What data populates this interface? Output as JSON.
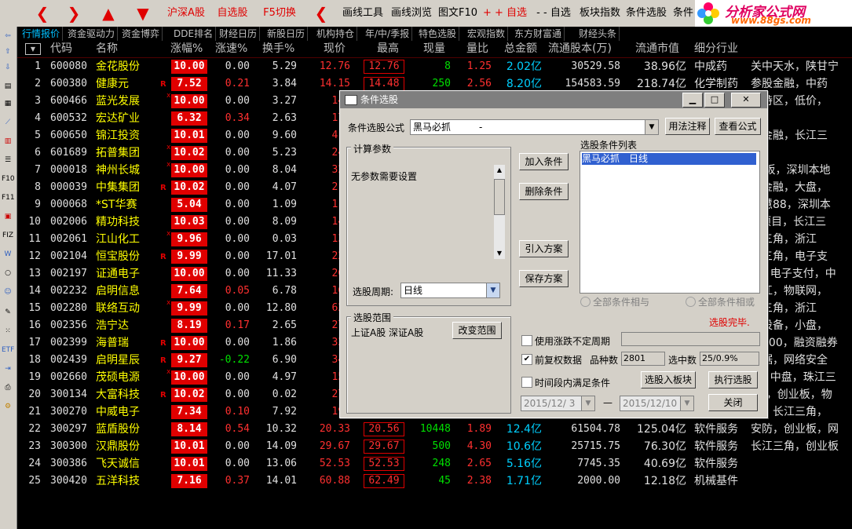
{
  "toolbar": {
    "tabs": [
      "沪深A股",
      "自选股",
      "F5切换",
      "画线工具",
      "画线浏览",
      "图文F10",
      "+ + 自选",
      "- - 自选",
      "板块指数",
      "条件选股",
      "条件"
    ],
    "logo_text": "分析家公式网",
    "logo_url": "www.88gs.com"
  },
  "left_icons": [
    "F10",
    "F11",
    "FIZ",
    "W",
    "ETF"
  ],
  "tabs": [
    "行情报价",
    "资金驱动力",
    "资金博弈",
    "DDE排名",
    "财经日历",
    "新股日历",
    "机构持仓",
    "年/中/季报",
    "特色选股",
    "宏观指数",
    "东方财富通",
    "财经头条"
  ],
  "columns": [
    "代码",
    "名称",
    "涨幅%",
    "涨速%",
    "换手%",
    "现价",
    "最高",
    "现量",
    "量比",
    "总金额",
    "流通股本(万)",
    "流通市值",
    "细分行业"
  ],
  "rows": [
    {
      "no": "1",
      "code": "600080",
      "name": "金花股份",
      "mark": "",
      "chg": "10.00",
      "spd": "0.00",
      "turn": "5.29",
      "price": "12.76",
      "high": "12.76",
      "vol": "8",
      "ratio": "1.25",
      "amt": "2.02亿",
      "float": "30529.58",
      "fmv": "38.96亿",
      "ind": "中成药",
      "extra": "关中天水，陕甘宁"
    },
    {
      "no": "2",
      "code": "600380",
      "name": "健康元",
      "mark": "R",
      "chg": "7.52",
      "spd": "0.21",
      "turn": "3.84",
      "price": "14.15",
      "high": "14.48",
      "vol": "250",
      "ratio": "2.56",
      "amt": "8.20亿",
      "float": "154583.59",
      "fmv": "218.74亿",
      "ind": "化学制药",
      "extra": "参股金融，中药"
    },
    {
      "no": "3",
      "code": "600466",
      "name": "蓝光发展",
      "mark": "x",
      "chg": "10.00",
      "spd": "0.00",
      "turn": "3.27",
      "price": "14.",
      "high": "",
      "vol": "",
      "ratio": "",
      "amt": "",
      "float": "",
      "fmv": "",
      "ind": "",
      "extra": "渝特区，低价，"
    },
    {
      "no": "4",
      "code": "600532",
      "name": "宏达矿业",
      "mark": "",
      "chg": "6.32",
      "spd": "0.34",
      "turn": "2.63",
      "price": "17.",
      "high": "",
      "vol": "",
      "ratio": "",
      "amt": "",
      "float": "",
      "fmv": "",
      "ind": "",
      "extra": ""
    },
    {
      "no": "5",
      "code": "600650",
      "name": "锦江投资",
      "mark": "",
      "chg": "10.01",
      "spd": "0.00",
      "turn": "9.60",
      "price": "41.",
      "high": "",
      "vol": "",
      "ratio": "",
      "amt": "",
      "float": "",
      "fmv": "",
      "ind": "",
      "extra": "股金融，长江三"
    },
    {
      "no": "6",
      "code": "601689",
      "name": "拓普集团",
      "mark": "x",
      "chg": "10.02",
      "spd": "0.00",
      "turn": "5.23",
      "price": "24.",
      "high": "",
      "vol": "",
      "ratio": "",
      "amt": "",
      "float": "",
      "fmv": "",
      "ind": "",
      "extra": ""
    },
    {
      "no": "7",
      "code": "000018",
      "name": "神州长城",
      "mark": "x",
      "chg": "10.00",
      "spd": "0.00",
      "turn": "8.04",
      "price": "32.",
      "high": "",
      "vol": "",
      "ratio": "",
      "amt": "",
      "float": "",
      "fmv": "",
      "ind": "",
      "extra": "ST板，深圳本地"
    },
    {
      "no": "8",
      "code": "000039",
      "name": "中集集团",
      "mark": "R",
      "chg": "10.02",
      "spd": "0.00",
      "turn": "4.07",
      "price": "21.",
      "high": "",
      "vol": "",
      "ratio": "",
      "amt": "",
      "float": "",
      "fmv": "",
      "ind": "",
      "extra": "股金融，大盘，"
    },
    {
      "no": "9",
      "code": "000068",
      "name": "*ST华赛",
      "mark": "",
      "chg": "5.04",
      "spd": "0.00",
      "turn": "1.09",
      "price": "11.",
      "high": "",
      "vol": "",
      "ratio": "",
      "amt": "",
      "float": "",
      "fmv": "",
      "ind": "",
      "extra": "智慧88，深圳本"
    },
    {
      "no": "10",
      "code": "002006",
      "name": "精功科技",
      "mark": "",
      "chg": "10.03",
      "spd": "0.00",
      "turn": "8.09",
      "price": "14.",
      "high": "",
      "vol": "",
      "ratio": "",
      "amt": "",
      "float": "",
      "fmv": "",
      "ind": "",
      "extra": "M项目，长江三"
    },
    {
      "no": "11",
      "code": "002061",
      "name": "江山化工",
      "mark": "x",
      "chg": "9.96",
      "spd": "0.00",
      "turn": "0.03",
      "price": "13.",
      "high": "",
      "vol": "",
      "ratio": "",
      "amt": "",
      "float": "",
      "fmv": "",
      "ind": "",
      "extra": "江三角，浙江"
    },
    {
      "no": "12",
      "code": "002104",
      "name": "恒宝股份",
      "mark": "R",
      "chg": "9.99",
      "spd": "0.00",
      "turn": "17.01",
      "price": "22.",
      "high": "",
      "vol": "",
      "ratio": "",
      "amt": "",
      "float": "",
      "fmv": "",
      "ind": "",
      "extra": "江三角，电子支"
    },
    {
      "no": "13",
      "code": "002197",
      "name": "证通电子",
      "mark": "",
      "chg": "10.00",
      "spd": "0.00",
      "turn": "11.33",
      "price": "26.",
      "high": "",
      "vol": "",
      "ratio": "",
      "amt": "",
      "float": "",
      "fmv": "",
      "ind": "",
      "extra": "D，电子支付，中"
    },
    {
      "no": "14",
      "code": "002232",
      "name": "启明信息",
      "mark": "",
      "chg": "7.64",
      "spd": "0.05",
      "turn": "6.78",
      "price": "16.",
      "high": "",
      "vol": "",
      "ratio": "",
      "amt": "",
      "float": "",
      "fmv": "",
      "ind": "",
      "extra": "门江，物联网，"
    },
    {
      "no": "15",
      "code": "002280",
      "name": "联络互动",
      "mark": "x",
      "chg": "9.99",
      "spd": "0.00",
      "turn": "12.80",
      "price": "62.",
      "high": "",
      "vol": "",
      "ratio": "",
      "amt": "",
      "float": "",
      "fmv": "",
      "ind": "",
      "extra": "江三角，浙江"
    },
    {
      "no": "16",
      "code": "002356",
      "name": "浩宁达",
      "mark": "",
      "chg": "8.19",
      "spd": "0.17",
      "turn": "2.65",
      "price": "27.",
      "high": "",
      "vol": "",
      "ratio": "",
      "amt": "",
      "float": "",
      "fmv": "",
      "ind": "",
      "extra": "力设备，小盘，"
    },
    {
      "no": "17",
      "code": "002399",
      "name": "海普瑞",
      "mark": "R",
      "chg": "10.00",
      "spd": "0.00",
      "turn": "1.86",
      "price": "33.",
      "high": "",
      "vol": "",
      "ratio": "",
      "amt": "",
      "float": "",
      "fmv": "",
      "ind": "",
      "extra": "深300，融资融券"
    },
    {
      "no": "18",
      "code": "002439",
      "name": "启明星辰",
      "mark": "R",
      "chg": "9.27",
      "spd": "-0.22",
      "turn": "6.90",
      "price": "34.",
      "high": "",
      "vol": "",
      "ratio": "",
      "amt": "",
      "float": "",
      "fmv": "",
      "ind": "",
      "extra": "数据，网络安全"
    },
    {
      "no": "19",
      "code": "002660",
      "name": "茂硕电源",
      "mark": "x",
      "chg": "10.00",
      "spd": "0.00",
      "turn": "4.97",
      "price": "15.",
      "high": "",
      "vol": "",
      "ratio": "",
      "amt": "",
      "float": "",
      "fmv": "",
      "ind": "",
      "extra": "D，中盘，珠江三"
    },
    {
      "no": "20",
      "code": "300134",
      "name": "大富科技",
      "mark": "R",
      "chg": "10.02",
      "spd": "0.00",
      "turn": "0.02",
      "price": "27.",
      "high": "",
      "vol": "",
      "ratio": "",
      "amt": "",
      "float": "",
      "fmv": "",
      "ind": "",
      "extra": "5G，创业板，物"
    },
    {
      "no": "21",
      "code": "300270",
      "name": "中威电子",
      "mark": "",
      "chg": "7.34",
      "spd": "0.10",
      "turn": "7.92",
      "price": "19.",
      "high": "",
      "vol": "",
      "ratio": "",
      "amt": "",
      "float": "",
      "fmv": "",
      "ind": "",
      "extra": "防，长江三角，"
    },
    {
      "no": "22",
      "code": "300297",
      "name": "蓝盾股份",
      "mark": "",
      "chg": "8.14",
      "spd": "0.54",
      "turn": "10.32",
      "price": "20.33",
      "high": "20.56",
      "vol": "10448",
      "ratio": "1.89",
      "amt": "12.4亿",
      "float": "61504.78",
      "fmv": "125.04亿",
      "ind": "软件服务",
      "extra": "安防，创业板，网"
    },
    {
      "no": "23",
      "code": "300300",
      "name": "汉鼎股份",
      "mark": "",
      "chg": "10.01",
      "spd": "0.00",
      "turn": "14.09",
      "price": "29.67",
      "high": "29.67",
      "vol": "500",
      "ratio": "4.30",
      "amt": "10.6亿",
      "float": "25715.75",
      "fmv": "76.30亿",
      "ind": "软件服务",
      "extra": "长江三角，创业板"
    },
    {
      "no": "24",
      "code": "300386",
      "name": "飞天诚信",
      "mark": "",
      "chg": "10.01",
      "spd": "0.00",
      "turn": "13.06",
      "price": "52.53",
      "high": "52.53",
      "vol": "248",
      "ratio": "2.65",
      "amt": "5.16亿",
      "float": "7745.35",
      "fmv": "40.69亿",
      "ind": "软件服务",
      "extra": ""
    },
    {
      "no": "25",
      "code": "300420",
      "name": "五洋科技",
      "mark": "",
      "chg": "7.16",
      "spd": "0.37",
      "turn": "14.01",
      "price": "60.88",
      "high": "62.49",
      "vol": "45",
      "ratio": "2.38",
      "amt": "1.71亿",
      "float": "2000.00",
      "fmv": "12.18亿",
      "ind": "机械基件",
      "extra": ""
    }
  ],
  "dialog": {
    "title": "条件选股",
    "formula_label": "条件选股公式",
    "formula_value": "黑马必抓　　　-",
    "btn_usage": "用法注释",
    "btn_view": "查看公式",
    "params_group": "计算参数",
    "no_params": "无参数需要设置",
    "period_label": "选股周期:",
    "period_value": "日线",
    "range_group": "选股范围",
    "range_value": "上证A股 深证A股",
    "btn_change_range": "改变范围",
    "btn_add": "加入条件",
    "btn_delete": "删除条件",
    "btn_import": "引入方案",
    "btn_save": "保存方案",
    "list_label": "选股条件列表",
    "list_item": "黑马必抓　日线",
    "radio_and": "全部条件相与",
    "radio_or": "全部条件相或",
    "status": "选股完毕.",
    "chk_uncertain": "使用涨跌不定周期",
    "chk_restore": "前复权数据",
    "count_label": "品种数",
    "count_value": "2801",
    "selected_label": "选中数",
    "selected_value": "25/0.9%",
    "chk_period": "时间段内满足条件",
    "btn_to_block": "选股入板块",
    "btn_execute": "执行选股",
    "date_from": "2015/12/ 3",
    "date_sep": "—",
    "date_to": "2015/12/10",
    "btn_close": "关闭"
  },
  "colors": {
    "up": "#ff3030",
    "down": "#00e000",
    "flat": "#e0e0e0",
    "code": "#e0e0e0",
    "name": "#ffff00",
    "amount": "#00d0ff"
  }
}
